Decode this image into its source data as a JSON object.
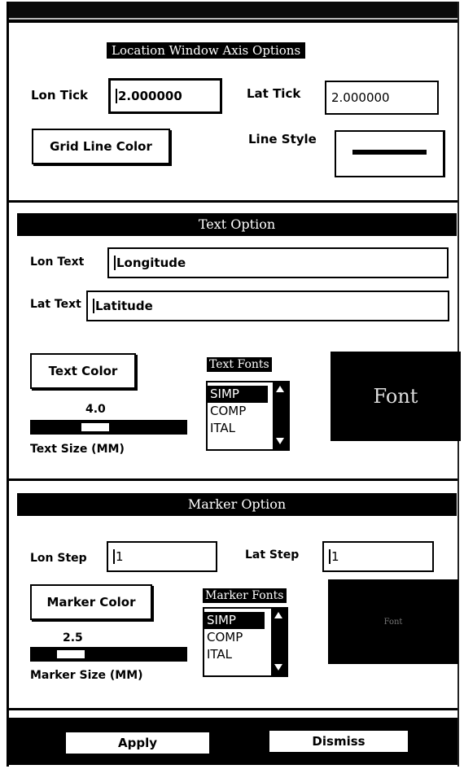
{
  "axis_options": {
    "title": "Location Window Axis Options",
    "lon_tick_label": "Lon Tick",
    "lon_tick_value": "2.000000",
    "lat_tick_label": "Lat Tick",
    "lat_tick_value": "2.000000",
    "grid_line_color_button": "Grid Line Color",
    "line_style_label": "Line Style"
  },
  "text_option": {
    "title": "Text Option",
    "lon_text_label": "Lon Text",
    "lon_text_value": "Longitude",
    "lat_text_label": "Lat Text",
    "lat_text_value": "Latitude",
    "text_color_button": "Text Color",
    "text_size_value": "4.0",
    "text_size_label": "Text Size (MM)",
    "text_size_level": 0.4,
    "fonts_title": "Text Fonts",
    "fonts": [
      "SIMP",
      "COMP",
      "ITAL"
    ],
    "selected_font": "SIMP",
    "font_preview": "Font"
  },
  "marker_option": {
    "title": "Marker Option",
    "lon_step_label": "Lon Step",
    "lon_step_value": "1",
    "lat_step_label": "Lat Step",
    "lat_step_value": "1",
    "marker_color_button": "Marker Color",
    "marker_size_value": "2.5",
    "marker_size_label": "Marker Size (MM)",
    "marker_size_level": 0.25,
    "fonts_title": "Marker Fonts",
    "fonts": [
      "SIMP",
      "COMP",
      "ITAL"
    ],
    "selected_font": "SIMP",
    "font_preview": "Font"
  },
  "footer": {
    "apply_button": "Apply",
    "dismiss_button": "Dismiss"
  },
  "colors": {
    "background": "#ffffff",
    "foreground": "#000000"
  }
}
